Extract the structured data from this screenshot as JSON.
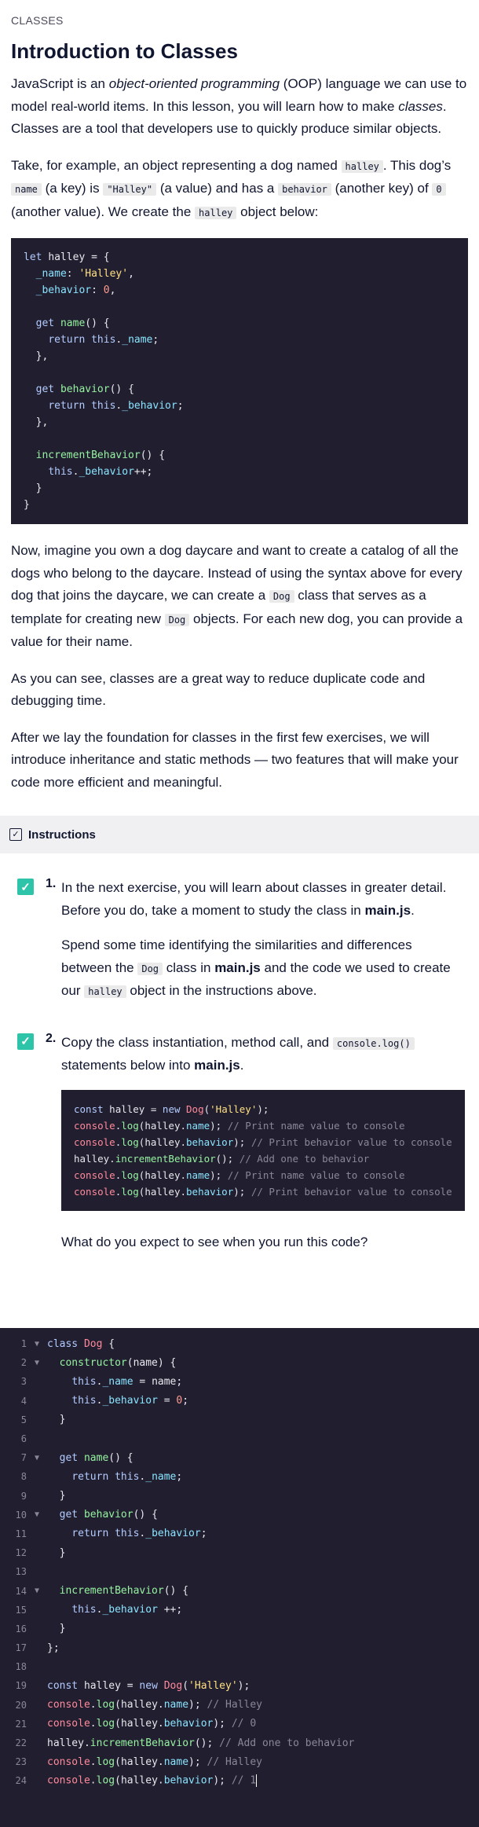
{
  "lesson": {
    "kicker": "CLASSES",
    "title": "Introduction to Classes",
    "p1": {
      "a": "JavaScript is an ",
      "em1": "object-oriented programming",
      "b": " (OOP) language we can use to model real-world items. In this lesson, you will learn how to make ",
      "em2": "classes",
      "c": ". Classes are a tool that developers use to quickly produce similar objects."
    },
    "p2": {
      "a": "Take, for example, an object representing a dog named ",
      "code1": "halley",
      "b": ". This dog’s ",
      "code2": "name",
      "c": " (a key) is ",
      "code3": "\"Halley\"",
      "d": " (a value) and has a ",
      "code4": "behavior",
      "e": " (another key) of ",
      "code5": "0",
      "f": " (another value). We create the ",
      "code6": "halley",
      "g": " object below:"
    },
    "code_example": [
      "let halley = {",
      "  _name: 'Halley',",
      "  _behavior: 0,",
      "",
      "  get name() {",
      "    return this._name;",
      "  },",
      "",
      "  get behavior() {",
      "    return this._behavior;",
      "  },",
      "",
      "  incrementBehavior() {",
      "    this._behavior++;",
      "  }",
      "}"
    ],
    "p3": {
      "a": "Now, imagine you own a dog daycare and want to create a catalog of all the dogs who belong to the daycare. Instead of using the syntax above for every dog that joins the daycare, we can create a ",
      "code1": "Dog",
      "b": " class that serves as a template for creating new ",
      "code2": "Dog",
      "c": " objects. For each new dog, you can provide a value for their name."
    },
    "p4": "As you can see, classes are a great way to reduce duplicate code and debugging time.",
    "p5": "After we lay the foundation for classes in the first few exercises, we will introduce inheritance and static methods — two features that will make your code more efficient and meaningful."
  },
  "instructions": {
    "label": "Instructions",
    "check_glyph": "✓",
    "tasks": [
      {
        "number": "1.",
        "p1": {
          "a": "In the next exercise, you will learn about classes in greater detail. Before you do, take a moment to study the class in ",
          "bold": "main.js",
          "b": "."
        },
        "p2": {
          "a": "Spend some time identifying the similarities and differences between the ",
          "code1": "Dog",
          "b": " class in ",
          "bold": "main.js",
          "c": " and the code we used to create our ",
          "code2": "halley",
          "d": " object in the instructions above."
        }
      },
      {
        "number": "2.",
        "p1": {
          "a": "Copy the class instantiation, method call, and ",
          "code1": "console.log()",
          "b": " statements below into ",
          "bold": "main.js",
          "c": "."
        },
        "code": [
          "const halley = new Dog('Halley');",
          "console.log(halley.name); // Print name value to console",
          "console.log(halley.behavior); // Print behavior value to console",
          "halley.incrementBehavior(); // Add one to behavior",
          "console.log(halley.name); // Print name value to console",
          "console.log(halley.behavior); // Print behavior value to console"
        ],
        "question": "What do you expect to see when you run this code?"
      }
    ]
  },
  "editor": {
    "fold_glyph": "▼",
    "lines": [
      {
        "n": "1",
        "fold": true,
        "text": "class Dog {"
      },
      {
        "n": "2",
        "fold": true,
        "text": "  constructor(name) {"
      },
      {
        "n": "3",
        "fold": false,
        "text": "    this._name = name;"
      },
      {
        "n": "4",
        "fold": false,
        "text": "    this._behavior = 0;"
      },
      {
        "n": "5",
        "fold": false,
        "text": "  }"
      },
      {
        "n": "6",
        "fold": false,
        "text": ""
      },
      {
        "n": "7",
        "fold": true,
        "text": "  get name() {"
      },
      {
        "n": "8",
        "fold": false,
        "text": "    return this._name;"
      },
      {
        "n": "9",
        "fold": false,
        "text": "  }"
      },
      {
        "n": "10",
        "fold": true,
        "text": "  get behavior() {"
      },
      {
        "n": "11",
        "fold": false,
        "text": "    return this._behavior;"
      },
      {
        "n": "12",
        "fold": false,
        "text": "  }"
      },
      {
        "n": "13",
        "fold": false,
        "text": ""
      },
      {
        "n": "14",
        "fold": true,
        "text": "  incrementBehavior() {"
      },
      {
        "n": "15",
        "fold": false,
        "text": "    this._behavior ++;"
      },
      {
        "n": "16",
        "fold": false,
        "text": "  }"
      },
      {
        "n": "17",
        "fold": false,
        "text": "};"
      },
      {
        "n": "18",
        "fold": false,
        "text": ""
      },
      {
        "n": "19",
        "fold": false,
        "text": "const halley = new Dog('Halley');"
      },
      {
        "n": "20",
        "fold": false,
        "text": "console.log(halley.name); // Halley"
      },
      {
        "n": "21",
        "fold": false,
        "text": "console.log(halley.behavior); // 0"
      },
      {
        "n": "22",
        "fold": false,
        "text": "halley.incrementBehavior(); // Add one to behavior"
      },
      {
        "n": "23",
        "fold": false,
        "text": "console.log(halley.name); // Halley"
      },
      {
        "n": "24",
        "fold": false,
        "text": "console.log(halley.behavior); // 1"
      }
    ]
  },
  "colors": {
    "accent_check": "#2ec4a9",
    "code_bg": "#211e2f",
    "instructions_bar_bg": "#f0f0f2"
  }
}
